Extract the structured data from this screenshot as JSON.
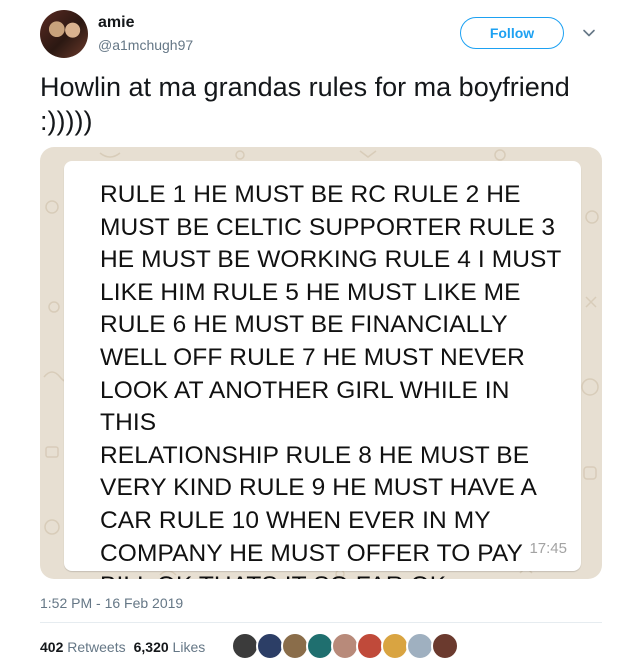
{
  "author": {
    "name": "amie",
    "handle": "@a1mchugh97",
    "avatar_icon": "profile-photo"
  },
  "follow_label": "Follow",
  "tweet_text": "Howlin at ma grandas rules for ma boyfriend :)))))",
  "message": {
    "lines": [
      "RULE 1 HE MUST BE RC RULE 2 HE",
      "MUST BE CELTIC SUPPORTER RULE 3",
      "HE MUST BE WORKING RULE 4 I MUST",
      "LIKE HIM RULE 5 HE MUST LIKE ME",
      "RULE 6 HE MUST BE FINANCIALLY",
      "WELL OFF RULE 7 HE MUST NEVER",
      "LOOK AT ANOTHER GIRL WHILE IN THIS",
      "RELATIONSHIP RULE 8 HE MUST BE",
      "VERY KIND RULE 9 HE MUST HAVE A",
      "CAR RULE 10 WHEN EVER IN MY",
      "COMPANY HE MUST OFFER TO PAY",
      "BILL  OK THATS IT SO FAR  OK"
    ],
    "time": "17:45"
  },
  "timestamp": "1:52 PM - 16 Feb 2019",
  "stats": {
    "retweets_count": "402",
    "retweets_label": "Retweets",
    "likes_count": "6,320",
    "likes_label": "Likes"
  },
  "liker_colors": [
    "#3b3b3b",
    "#2c3e66",
    "#8a6d4a",
    "#1f6f6f",
    "#b88a7a",
    "#c04a3a",
    "#d9a441",
    "#9fb0c0",
    "#6b3a2e"
  ],
  "colors": {
    "accent": "#1da1f2",
    "secondary_text": "#657786",
    "chat_background": "#e7dfd2"
  }
}
